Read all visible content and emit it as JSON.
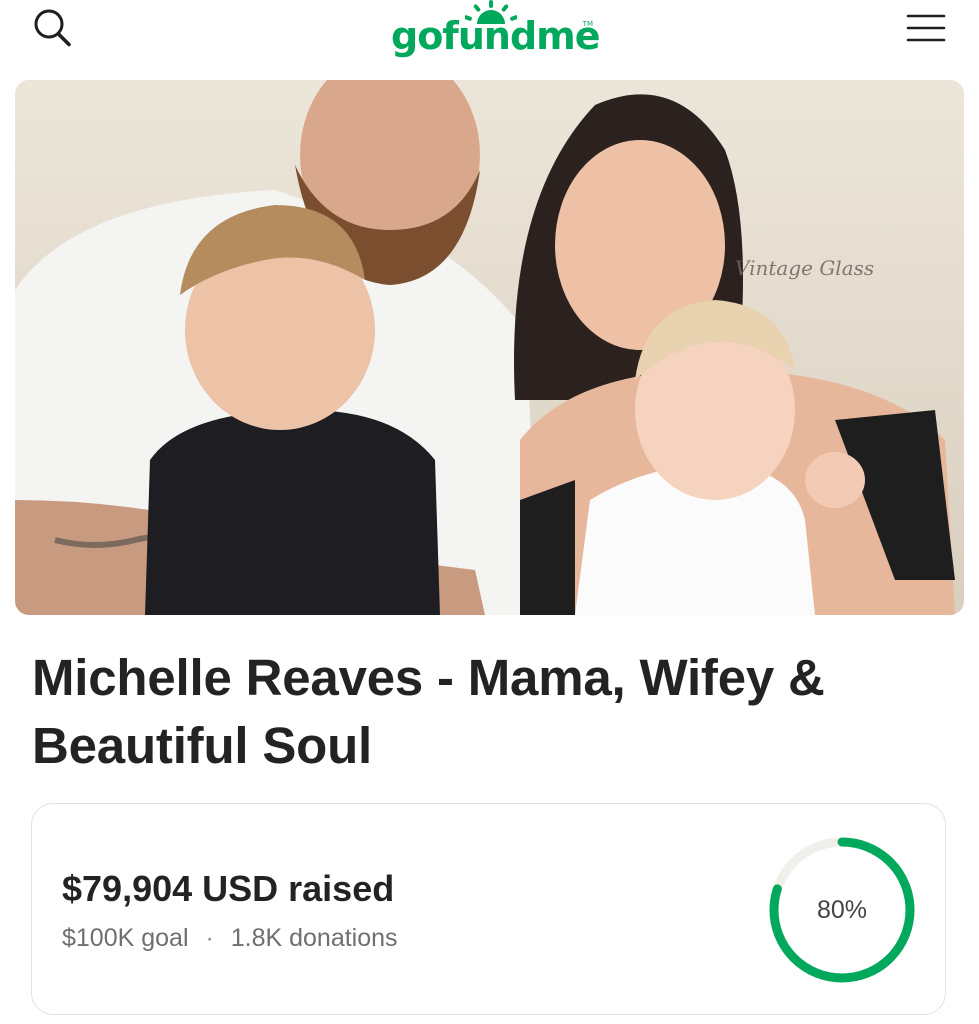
{
  "header": {
    "search_icon": "search-icon",
    "menu_icon": "hamburger-menu-icon",
    "logo": {
      "text": "gofundme",
      "trademark": "TM",
      "color": "#02a95c"
    }
  },
  "hero": {
    "watermark": "Vintage Glass"
  },
  "campaign": {
    "title": "Michelle Reaves - Mama, Wifey & Beautiful Soul"
  },
  "progress": {
    "raised": "$79,904 USD raised",
    "goal": "$100K goal",
    "separator": "·",
    "donations": "1.8K donations",
    "percent_label": "80%",
    "percent_value": 0.8,
    "ring_color": "#02a95c",
    "track_color": "#f0efea"
  }
}
